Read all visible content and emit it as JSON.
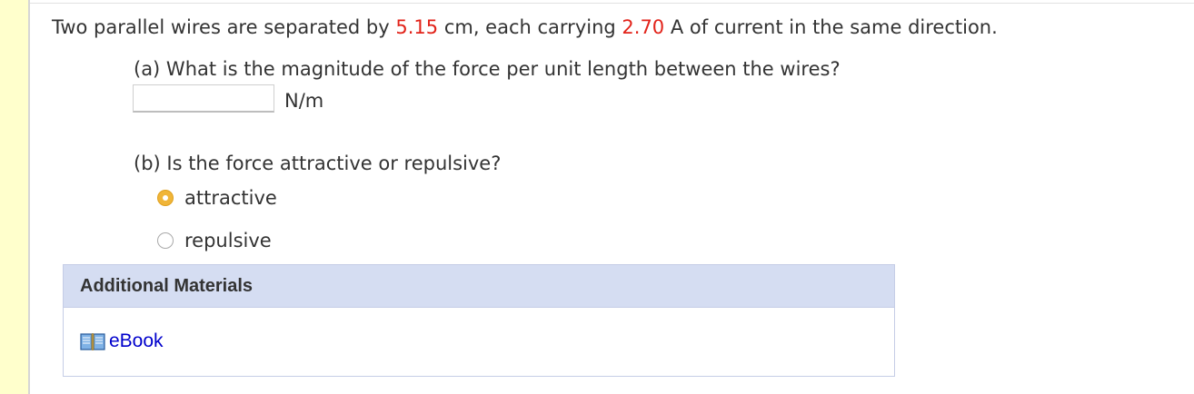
{
  "question": {
    "intro_part1": "Two parallel wires are separated by",
    "separation_value": "5.15",
    "intro_part2": "cm, each carrying",
    "current_value": "2.70",
    "intro_part3": "A of current in the same direction.",
    "part_a": {
      "label": "(a) What is the magnitude of the force per unit length between the wires?",
      "input_value": "",
      "unit": "N/m"
    },
    "part_b": {
      "label": "(b) Is the force attractive or repulsive?",
      "options": [
        {
          "label": "attractive",
          "selected": true
        },
        {
          "label": "repulsive",
          "selected": false
        }
      ]
    }
  },
  "additional_materials": {
    "header": "Additional Materials",
    "links": [
      {
        "label": "eBook",
        "icon": "book-icon"
      }
    ]
  },
  "colors": {
    "value_highlight": "#e2231a",
    "radio_selected": "#f0b538",
    "materials_header_bg": "#d5ddf2",
    "link": "#0000cc",
    "left_bar": "#ffffcc"
  }
}
